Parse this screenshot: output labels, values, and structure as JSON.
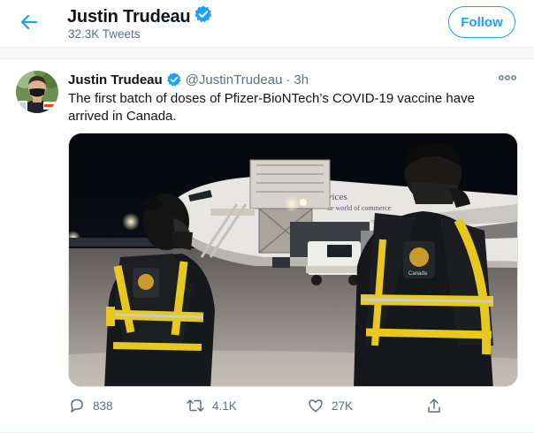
{
  "header": {
    "name": "Justin Trudeau",
    "tweet_count": "32.3K Tweets",
    "follow_label": "Follow"
  },
  "tweet": {
    "name": "Justin Trudeau",
    "handle": "@JustinTrudeau",
    "dot": "·",
    "time": "3h",
    "text": "The first batch of doses of Pfizer-BioNTech’s COVID-19 vaccine have arrived in Canada.",
    "aircraft_lettering": "vices he world of commerce",
    "vest_lettering": "Canada",
    "replies": "838",
    "retweets": "4.1K",
    "likes": "27K"
  },
  "colors": {
    "accent": "#1da1f2",
    "secondary_text": "#5b7083",
    "divider": "#ebeef0"
  },
  "icons": [
    "back-arrow-icon",
    "verified-badge-icon",
    "more-icon",
    "reply-icon",
    "retweet-icon",
    "like-icon",
    "share-icon"
  ]
}
